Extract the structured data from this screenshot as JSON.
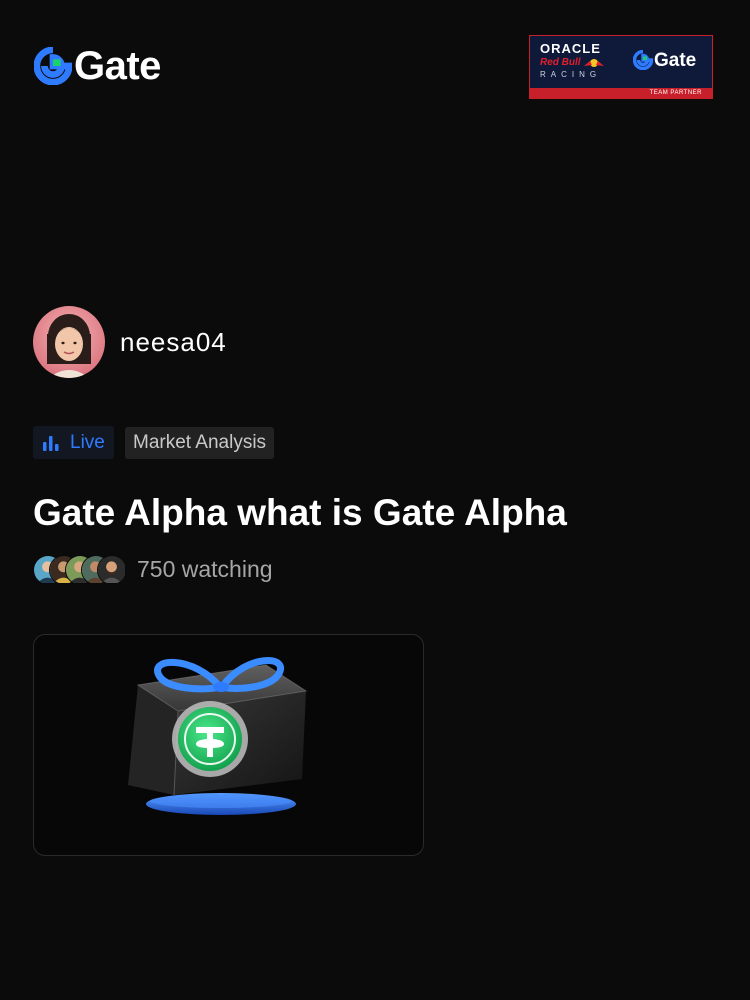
{
  "brand": {
    "name": "Gate",
    "icon": "gate-logo-icon",
    "accent": "#2f7bff",
    "green": "#19d26e"
  },
  "partner": {
    "oracle": "ORACLE",
    "redbull": "Red Bull",
    "racing": "RACING",
    "gate": "Gate",
    "band": "TEAM PARTNER"
  },
  "host": {
    "username": "neesa04",
    "avatar_icon": "host-avatar"
  },
  "tags": {
    "live": "Live",
    "live_icon": "bar-chart-icon",
    "category": "Market Analysis"
  },
  "stream": {
    "title": "Gate Alpha what is Gate Alpha",
    "watching": "750 watching"
  },
  "preview": {
    "image": "tether-gift-box-illustration"
  }
}
